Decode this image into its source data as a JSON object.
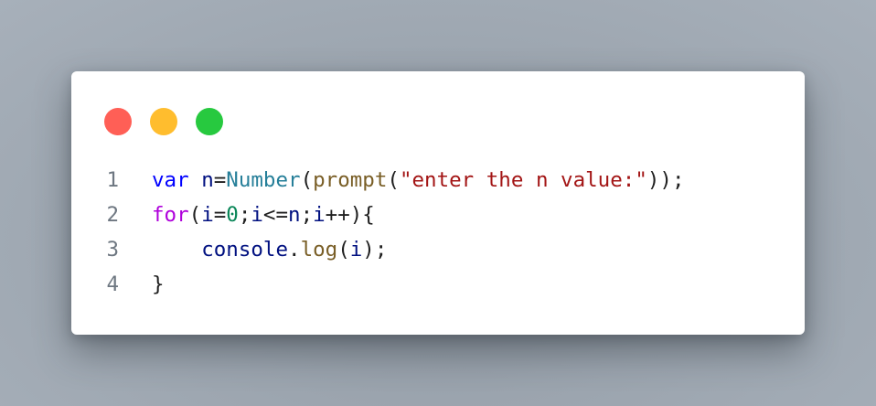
{
  "window": {
    "controls": [
      {
        "name": "close",
        "color": "#ff5f56"
      },
      {
        "name": "minimize",
        "color": "#ffbd2e"
      },
      {
        "name": "maximize",
        "color": "#27c93f"
      }
    ]
  },
  "code": {
    "language": "javascript",
    "lines": [
      {
        "number": "1",
        "tokens": [
          {
            "text": "var",
            "kind": "kw"
          },
          {
            "text": " ",
            "kind": "op"
          },
          {
            "text": "n",
            "kind": "var"
          },
          {
            "text": "=",
            "kind": "op"
          },
          {
            "text": "Number",
            "kind": "ty"
          },
          {
            "text": "(",
            "kind": "op"
          },
          {
            "text": "prompt",
            "kind": "fn"
          },
          {
            "text": "(",
            "kind": "op"
          },
          {
            "text": "\"enter the n value:\"",
            "kind": "str"
          },
          {
            "text": "));",
            "kind": "op"
          }
        ]
      },
      {
        "number": "2",
        "tokens": [
          {
            "text": "for",
            "kind": "kw2"
          },
          {
            "text": "(",
            "kind": "op"
          },
          {
            "text": "i",
            "kind": "var"
          },
          {
            "text": "=",
            "kind": "op"
          },
          {
            "text": "0",
            "kind": "num"
          },
          {
            "text": ";",
            "kind": "op"
          },
          {
            "text": "i",
            "kind": "var"
          },
          {
            "text": "<=",
            "kind": "op"
          },
          {
            "text": "n",
            "kind": "var"
          },
          {
            "text": ";",
            "kind": "op"
          },
          {
            "text": "i",
            "kind": "var"
          },
          {
            "text": "++){",
            "kind": "op"
          }
        ]
      },
      {
        "number": "3",
        "tokens": [
          {
            "text": "    ",
            "kind": "op"
          },
          {
            "text": "console",
            "kind": "var"
          },
          {
            "text": ".",
            "kind": "op"
          },
          {
            "text": "log",
            "kind": "fn"
          },
          {
            "text": "(",
            "kind": "op"
          },
          {
            "text": "i",
            "kind": "var"
          },
          {
            "text": ");",
            "kind": "op"
          }
        ]
      },
      {
        "number": "4",
        "tokens": [
          {
            "text": "}",
            "kind": "op"
          }
        ]
      }
    ]
  }
}
